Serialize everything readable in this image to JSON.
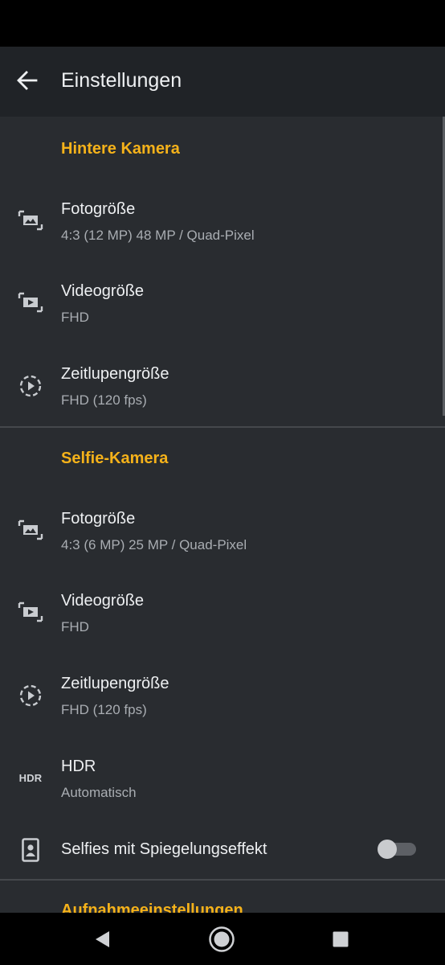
{
  "app_bar": {
    "title": "Einstellungen"
  },
  "rear_camera": {
    "header": "Hintere Kamera",
    "photo_size": {
      "title": "Fotogröße",
      "value": "4:3 (12 MP) 48 MP / Quad-Pixel"
    },
    "video_size": {
      "title": "Videogröße",
      "value": "FHD"
    },
    "slowmo_size": {
      "title": "Zeitlupengröße",
      "value": "FHD (120 fps)"
    }
  },
  "selfie_camera": {
    "header": "Selfie-Kamera",
    "photo_size": {
      "title": "Fotogröße",
      "value": "4:3 (6 MP) 25 MP / Quad-Pixel"
    },
    "video_size": {
      "title": "Videogröße",
      "value": "FHD"
    },
    "slowmo_size": {
      "title": "Zeitlupengröße",
      "value": "FHD (120 fps)"
    },
    "hdr": {
      "icon_label": "HDR",
      "title": "HDR",
      "value": "Automatisch"
    },
    "mirror": {
      "title": "Selfies mit Spiegelungseffekt",
      "enabled": false
    }
  },
  "capture_settings": {
    "header": "Aufnahmeeinstellungen"
  },
  "colors": {
    "accent": "#f5b21a",
    "background": "#292c30",
    "app_bar": "#202327"
  },
  "icons": {
    "back": "arrow-left-icon",
    "photo": "photo-size-icon",
    "video": "video-size-icon",
    "slowmo": "slow-motion-icon",
    "hdr": "hdr-icon",
    "mirror": "selfie-mirror-icon",
    "nav_back": "triangle-back-icon",
    "nav_home": "circle-home-icon",
    "nav_recents": "square-recents-icon"
  }
}
